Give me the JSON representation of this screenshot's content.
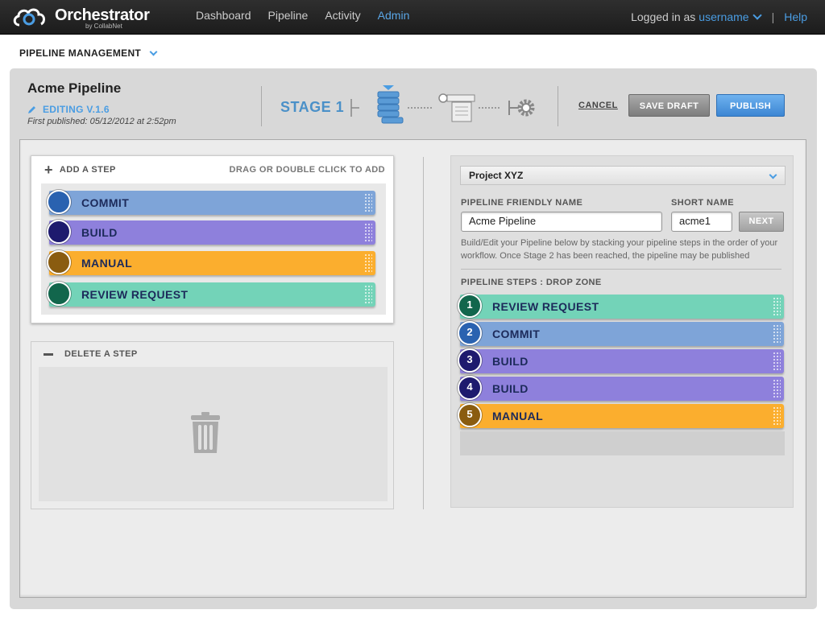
{
  "app": {
    "title": "Orchestrator",
    "subtitle": "by CollabNet"
  },
  "nav": [
    {
      "label": "Dashboard",
      "active": false
    },
    {
      "label": "Pipeline",
      "active": false
    },
    {
      "label": "Activity",
      "active": false
    },
    {
      "label": "Admin",
      "active": true
    }
  ],
  "user": {
    "prefix": "Logged in as",
    "username": "username",
    "separator": "|",
    "help": "Help"
  },
  "section": {
    "title": "PIPELINE MANAGEMENT"
  },
  "pipeline": {
    "name": "Acme Pipeline",
    "editing": "EDITING V.1.6",
    "published": "First published: 05/12/2012 at 2:52pm",
    "stage": "STAGE 1"
  },
  "actions": {
    "cancel": "CANCEL",
    "save_draft": "SAVE DRAFT",
    "publish": "PUBLISH"
  },
  "add_step": {
    "title": "ADD A STEP",
    "hint": "DRAG OR DOUBLE CLICK TO ADD",
    "steps": [
      {
        "label": "COMMIT",
        "color": "#7ea4d8",
        "circle": "#2a62b0"
      },
      {
        "label": "BUILD",
        "color": "#8e80dc",
        "circle": "#1e1a6e"
      },
      {
        "label": "MANUAL",
        "color": "#fbae2e",
        "circle": "#8a5c10"
      },
      {
        "label": "REVIEW REQUEST",
        "color": "#73d3b8",
        "circle": "#12664c"
      }
    ]
  },
  "delete_step": {
    "title": "DELETE A STEP"
  },
  "form": {
    "project": "Project XYZ",
    "friendly_name_label": "PIPELINE FRIENDLY NAME",
    "friendly_name_value": "Acme Pipeline",
    "short_name_label": "SHORT NAME",
    "short_name_value": "acme1",
    "next": "NEXT",
    "description": "Build/Edit your Pipeline below by stacking your pipeline steps in the order of your workflow. Once Stage 2 has been reached, the pipeline may be published",
    "drop_zone_label": "PIPELINE STEPS : DROP ZONE"
  },
  "pipeline_steps": [
    {
      "num": "1",
      "label": "REVIEW REQUEST",
      "color": "#73d3b8",
      "circle": "#12664c"
    },
    {
      "num": "2",
      "label": "COMMIT",
      "color": "#7ea4d8",
      "circle": "#2a62b0"
    },
    {
      "num": "3",
      "label": "BUILD",
      "color": "#8e80dc",
      "circle": "#1e1a6e"
    },
    {
      "num": "4",
      "label": "BUILD",
      "color": "#8e80dc",
      "circle": "#1e1a6e"
    },
    {
      "num": "5",
      "label": "MANUAL",
      "color": "#fbae2e",
      "circle": "#8a5c10"
    }
  ]
}
